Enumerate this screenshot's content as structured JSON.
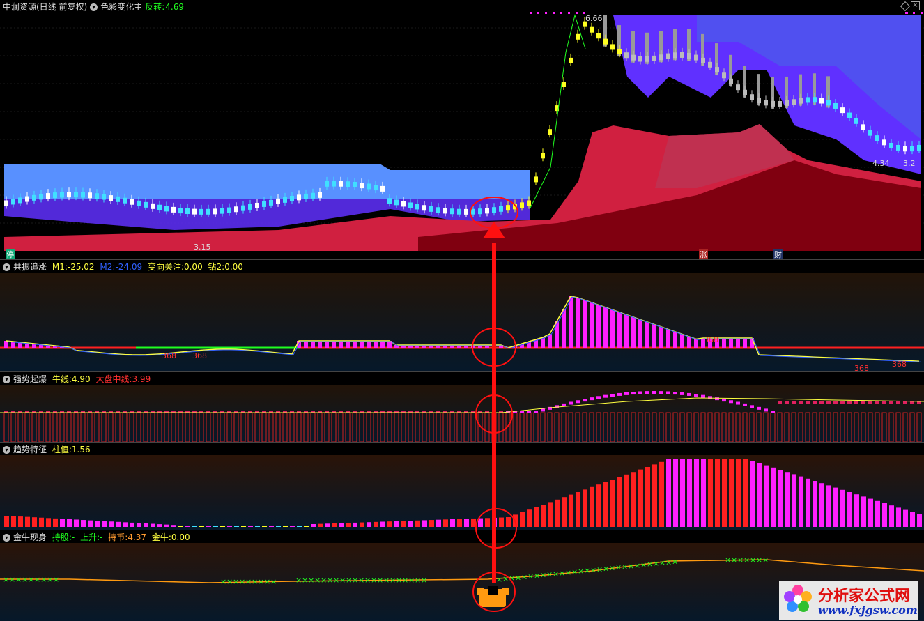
{
  "main_panel": {
    "title": "中润资源(日线 前复权)",
    "indicator": "色彩变化主",
    "reversal_label": "反转:",
    "reversal_value": "4.69",
    "high_label": "6.66",
    "low_label": "3.15",
    "right_label_1": "4.34",
    "right_label_2": "3.2",
    "tag_stop": "停",
    "tag_zhang": "涨",
    "tag_cai": "财"
  },
  "panel2": {
    "title": "共振追涨",
    "m1_label": "M1:",
    "m1_value": "-25.02",
    "m2_label": "M2:",
    "m2_value": "-24.09",
    "focus_label": "变向关注:",
    "focus_value": "0.00",
    "zuan_label": "钻2:",
    "zuan_value": "0.00",
    "tag_368": "368"
  },
  "panel3": {
    "title": "强势起爆",
    "bull_label": "牛线:",
    "bull_value": "4.90",
    "market_label": "大盘中线:",
    "market_value": "3.99"
  },
  "panel4": {
    "title": "趋势特征",
    "column_label": "柱值:",
    "column_value": "1.56"
  },
  "panel5": {
    "title": "金牛现身",
    "hold_label": "持股:",
    "hold_value": "-",
    "rise_label": "上升:",
    "rise_value": "-",
    "coin_label": "持币:",
    "coin_value": "4.37",
    "gold_label": "金牛:",
    "gold_value": "0.00"
  },
  "watermark": {
    "text": "分析家公式网",
    "url": "www.fxjgsw.com"
  },
  "colors": {
    "up": "#ff2020",
    "magenta": "#ff20ff",
    "cyan": "#40e0ff",
    "yellow": "#ffff20",
    "blue_band": "#5890ff",
    "violet": "#6030ff",
    "crimson": "#d02040",
    "darkred": "#800010",
    "green": "#20ff20",
    "orange": "#ff9a10"
  }
}
